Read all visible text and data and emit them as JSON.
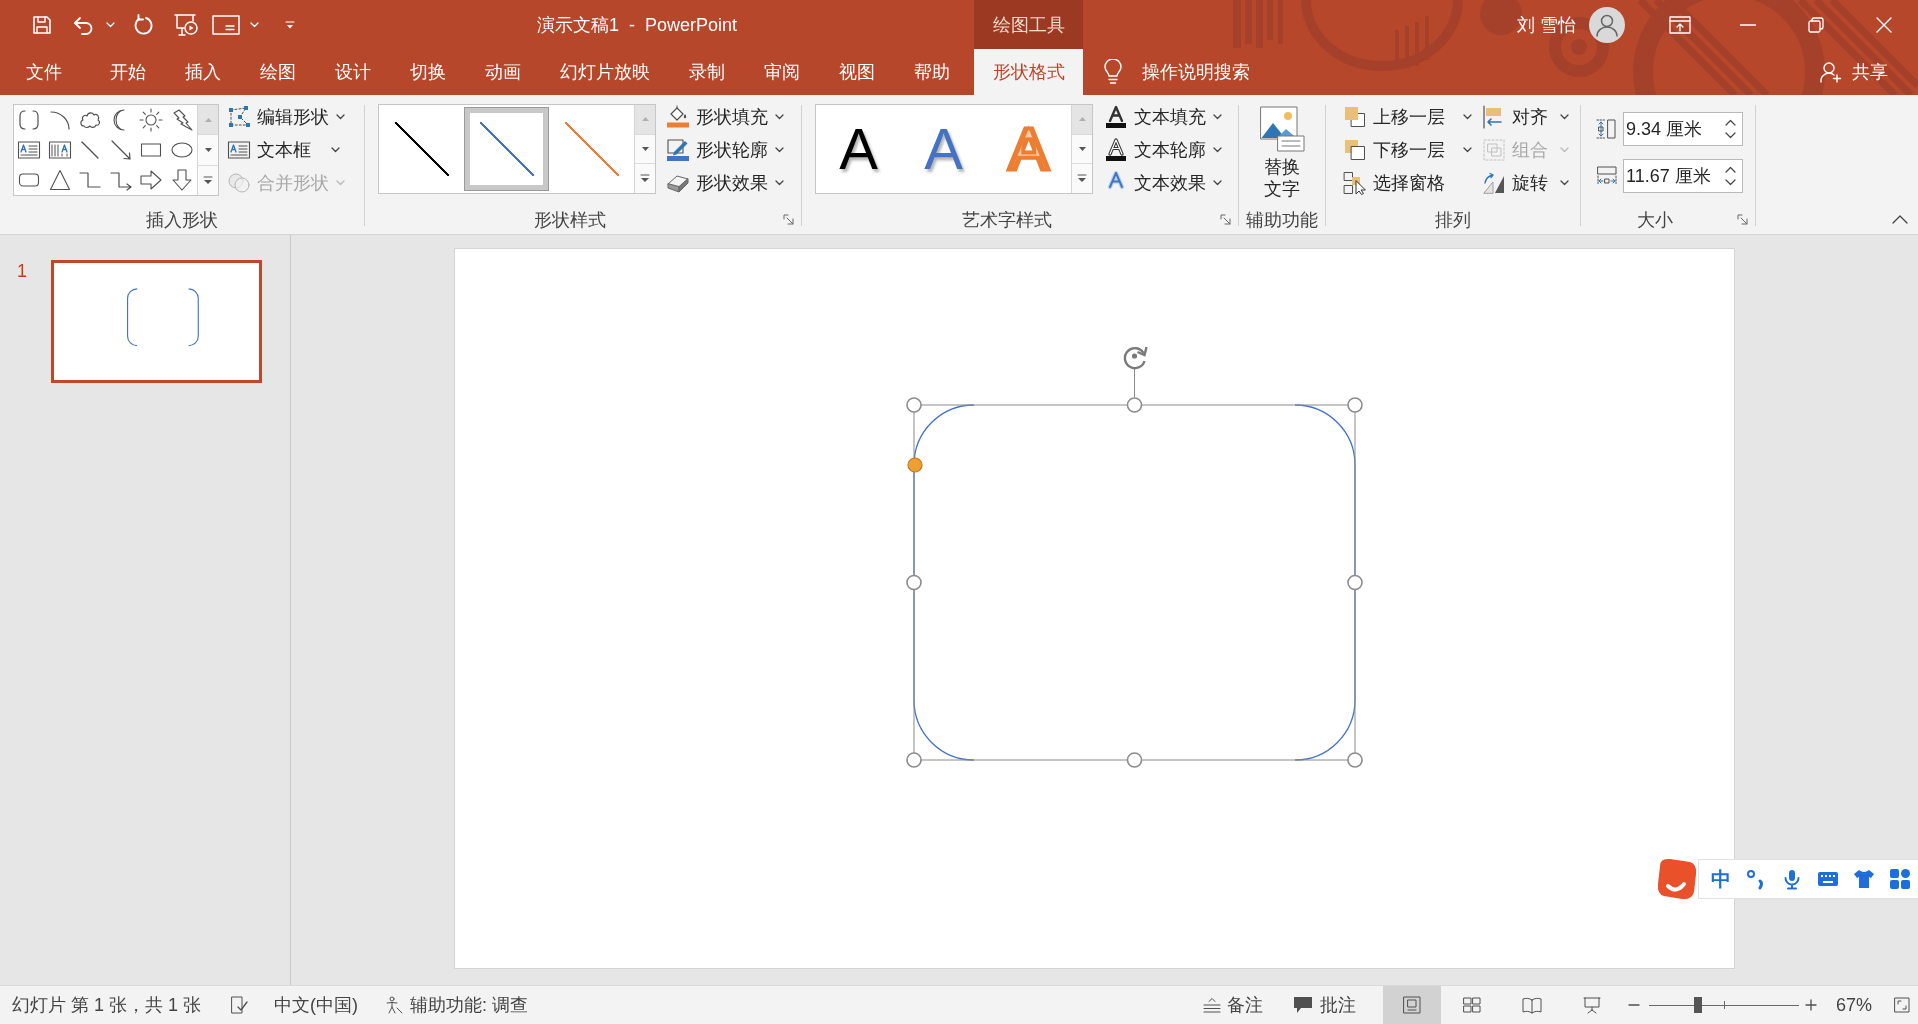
{
  "window": {
    "title": "演示文稿1  -  PowerPoint",
    "user": "刘 雪怡"
  },
  "tabs": [
    {
      "label": "文件",
      "selected": false
    },
    {
      "label": "开始",
      "selected": false
    },
    {
      "label": "插入",
      "selected": false
    },
    {
      "label": "绘图",
      "selected": false
    },
    {
      "label": "设计",
      "selected": false
    },
    {
      "label": "切换",
      "selected": false
    },
    {
      "label": "动画",
      "selected": false
    },
    {
      "label": "幻灯片放映",
      "selected": false
    },
    {
      "label": "录制",
      "selected": false
    },
    {
      "label": "审阅",
      "selected": false
    },
    {
      "label": "视图",
      "selected": false
    },
    {
      "label": "帮助",
      "selected": false
    }
  ],
  "context_tabs": {
    "title": "绘图工具",
    "tabs": [
      {
        "label": "形状格式",
        "selected": true
      }
    ]
  },
  "tell_me": {
    "label": "操作说明搜索"
  },
  "share": {
    "label": "共享"
  },
  "ribbon": {
    "groups": [
      {
        "kind": "insert_shapes",
        "title": "插入形状",
        "launcher": false,
        "commands": [
          {
            "label": "编辑形状",
            "kind": "edit_shape",
            "dropdown": true,
            "disabled": false
          },
          {
            "label": "文本框",
            "kind": "text_box",
            "dropdown": true,
            "disabled": false
          },
          {
            "label": "合并形状",
            "kind": "merge_shapes",
            "dropdown": true,
            "disabled": true
          }
        ]
      },
      {
        "kind": "shape_styles",
        "title": "形状样式",
        "launcher": true,
        "styles": [
          {
            "color": "#000000",
            "selected": false
          },
          {
            "color": "#4472c4",
            "selected": true
          },
          {
            "color": "#ed7d31",
            "selected": false
          }
        ],
        "commands": [
          {
            "label": "形状填充",
            "kind": "shape_fill",
            "dropdown": true,
            "disabled": false
          },
          {
            "label": "形状轮廓",
            "kind": "shape_outline",
            "dropdown": true,
            "disabled": false
          },
          {
            "label": "形状效果",
            "kind": "shape_effects",
            "dropdown": true,
            "disabled": false
          }
        ]
      },
      {
        "kind": "wordart_styles",
        "title": "艺术字样式",
        "launcher": true,
        "styles": [
          {
            "letter": "A",
            "kind": "solid",
            "color": "#000000",
            "selected": false
          },
          {
            "letter": "A",
            "kind": "solid",
            "color": "#4472c4",
            "selected": false
          },
          {
            "letter": "A",
            "kind": "outline",
            "color": "#ed7d31",
            "selected": false
          }
        ],
        "commands": [
          {
            "label": "文本填充",
            "kind": "text_fill",
            "dropdown": true,
            "disabled": false
          },
          {
            "label": "文本轮廓",
            "kind": "text_outline",
            "dropdown": true,
            "disabled": false
          },
          {
            "label": "文本效果",
            "kind": "text_effects",
            "dropdown": true,
            "disabled": false
          }
        ]
      },
      {
        "kind": "accessibility",
        "title": "辅助功能",
        "launcher": false,
        "button": {
          "label": "替换文字"
        }
      },
      {
        "kind": "arrange",
        "title": "排列",
        "launcher": false,
        "commands": [
          {
            "label": "上移一层",
            "kind": "bring_forward",
            "dropdown": true,
            "disabled": false
          },
          {
            "label": "下移一层",
            "kind": "send_backward",
            "dropdown": true,
            "disabled": false
          },
          {
            "label": "选择窗格",
            "kind": "selection_pane",
            "dropdown": false,
            "disabled": false
          },
          {
            "label": "对齐",
            "kind": "align",
            "dropdown": true,
            "disabled": false
          },
          {
            "label": "组合",
            "kind": "group",
            "dropdown": true,
            "disabled": true
          },
          {
            "label": "旋转",
            "kind": "rotate",
            "dropdown": true,
            "disabled": false
          }
        ]
      },
      {
        "kind": "size",
        "title": "大小",
        "launcher": true,
        "fields": [
          {
            "kind": "height",
            "value": "9.34 厘米"
          },
          {
            "kind": "width",
            "value": "11.67 厘米"
          }
        ]
      }
    ]
  },
  "thumbnails": [
    {
      "number": "1",
      "selected": true
    }
  ],
  "slide": {
    "shapes": [
      {
        "kind": "bracket_pair",
        "selected": true
      }
    ]
  },
  "ime_toolbar": {
    "mode": "中"
  },
  "status_bar": {
    "slide_info": "幻灯片 第 1 张，共 1 张",
    "language": "中文(中国)",
    "accessibility": "辅助功能: 调查",
    "notes": "备注",
    "comments": "批注",
    "views": [
      {
        "kind": "normal",
        "selected": true
      },
      {
        "kind": "sorter",
        "selected": false
      },
      {
        "kind": "reading",
        "selected": false
      },
      {
        "kind": "slideshow",
        "selected": false
      }
    ],
    "zoom": {
      "level": 0.33,
      "reading": "67%"
    }
  }
}
